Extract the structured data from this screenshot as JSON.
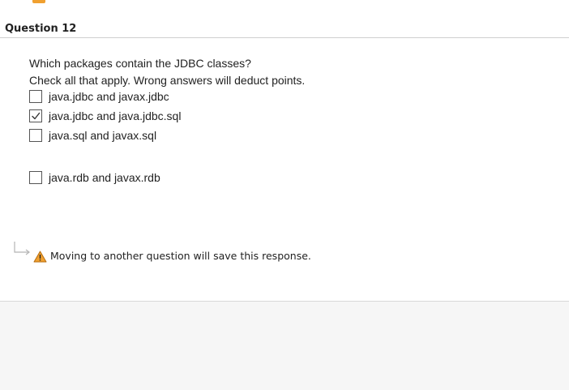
{
  "question": {
    "title": "Question 12",
    "prompt_line1": "Which packages contain the JDBC classes?",
    "prompt_line2": "Check all that apply. Wrong answers will deduct points.",
    "options": [
      {
        "label": "java.jdbc and javax.jdbc",
        "checked": false
      },
      {
        "label": "java.jdbc and java.jdbc.sql",
        "checked": true
      },
      {
        "label": "java.sql and javax.sql",
        "checked": false
      },
      {
        "label": "java.rdb and javax.rdb",
        "checked": false
      }
    ]
  },
  "hint": {
    "text": "Moving to another question will save this response.",
    "icon": "warning-icon",
    "arrow_icon": "return-arrow-icon"
  },
  "colors": {
    "warning_fill": "#f0a030",
    "divider": "#d0d0d0",
    "footer_bg": "#f6f6f6"
  }
}
